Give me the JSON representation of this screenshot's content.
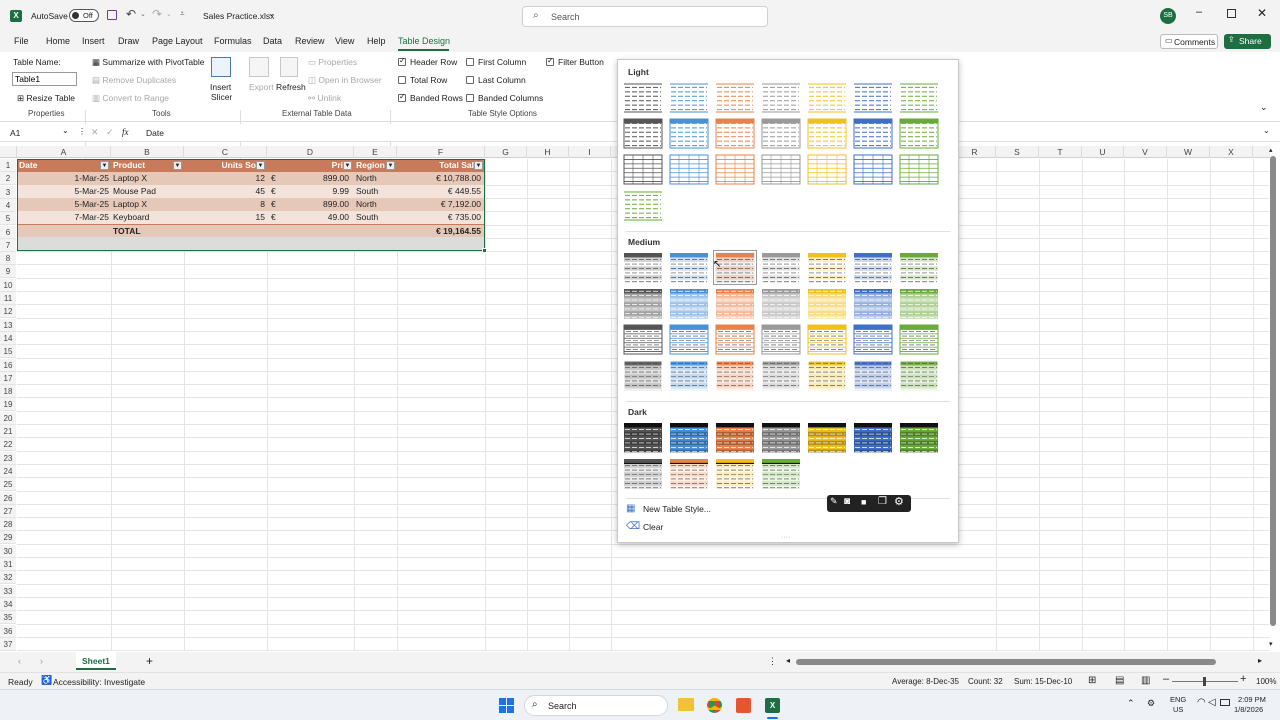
{
  "titlebar": {
    "autosave_label": "AutoSave",
    "autosave_state": "Off",
    "filename": "Sales Practice.xlsx",
    "search_placeholder": "Search",
    "avatar_initials": "SB"
  },
  "ribbon_tabs": [
    "File",
    "Home",
    "Insert",
    "Draw",
    "Page Layout",
    "Formulas",
    "Data",
    "Review",
    "View",
    "Help",
    "Table Design"
  ],
  "active_tab": "Table Design",
  "comments_label": "Comments",
  "share_label": "Share",
  "ribbon": {
    "table_name_label": "Table Name:",
    "table_name_value": "Table1",
    "resize_table": "Resize Table",
    "properties_group": "Properties",
    "summarize": "Summarize with PivotTable",
    "remove_duplicates": "Remove Duplicates",
    "convert_to_range": "Convert to Range",
    "tools_group": "Tools",
    "insert_slicer_1": "Insert",
    "insert_slicer_2": "Slicer",
    "export": "Export",
    "refresh": "Refresh",
    "properties": "Properties",
    "open_in_browser": "Open in Browser",
    "unlink": "Unlink",
    "external_group": "External Table Data",
    "header_row": "Header Row",
    "total_row": "Total Row",
    "banded_rows": "Banded Rows",
    "first_column": "First Column",
    "last_column": "Last Column",
    "banded_columns": "Banded Columns",
    "filter_button": "Filter Button",
    "options_group": "Table Style Options"
  },
  "formula_bar": {
    "name_box": "A1",
    "fx": "fx",
    "content": "Date"
  },
  "columns": [
    "A",
    "B",
    "C",
    "D",
    "E",
    "F",
    "G",
    "H",
    "I",
    "",
    "",
    "",
    "",
    "",
    "",
    "",
    "",
    "",
    "",
    "R",
    "S",
    "T",
    "U",
    "V",
    "W",
    "X"
  ],
  "table": {
    "headers": [
      "Date",
      "Product",
      "Units So",
      "Pri",
      "Region",
      "Total Sal"
    ],
    "rows": [
      [
        "1-Mar-25",
        "Laptop X",
        "12",
        "€",
        "899.00",
        "North",
        "€ 10,788.00"
      ],
      [
        "5-Mar-25",
        "Mouse Pad",
        "45",
        "€",
        "9.99",
        "South",
        "€ 449.55"
      ],
      [
        "5-Mar-25",
        "Laptop X",
        "8",
        "€",
        "899.00",
        "North",
        "€ 7,192.00"
      ],
      [
        "7-Mar-25",
        "Keyboard",
        "15",
        "€",
        "49.00",
        "South",
        "€ 735.00"
      ]
    ],
    "total_label": "TOTAL",
    "total_value": "€ 19,164.55"
  },
  "row_numbers": [
    "1",
    "2",
    "3",
    "4",
    "5",
    "6",
    "7",
    "8",
    "9",
    "10",
    "11",
    "12",
    "13",
    "14",
    "15",
    "16",
    "17",
    "18",
    "19",
    "20",
    "21",
    "22",
    "23",
    "24",
    "25",
    "26",
    "27",
    "28",
    "29",
    "30",
    "31",
    "32",
    "33",
    "34",
    "35",
    "36",
    "37"
  ],
  "gallery": {
    "light_label": "Light",
    "medium_label": "Medium",
    "dark_label": "Dark",
    "new_style": "New Table Style...",
    "clear": "Clear",
    "theme_colors": [
      "#555555",
      "#4a90d9",
      "#e8824a",
      "#9a9a9a",
      "#f0c020",
      "#3f6fc6",
      "#6aaa3a"
    ]
  },
  "sheet_tab": "Sheet1",
  "status": {
    "ready": "Ready",
    "accessibility": "Accessibility: Investigate",
    "average": "Average: 8-Dec-35",
    "count": "Count: 32",
    "sum": "Sum: 15-Dec-10",
    "zoom": "100%"
  },
  "taskbar": {
    "search": "Search",
    "lang1": "ENG",
    "lang2": "US",
    "time": "2:09 PM",
    "date": "1/8/2026"
  }
}
